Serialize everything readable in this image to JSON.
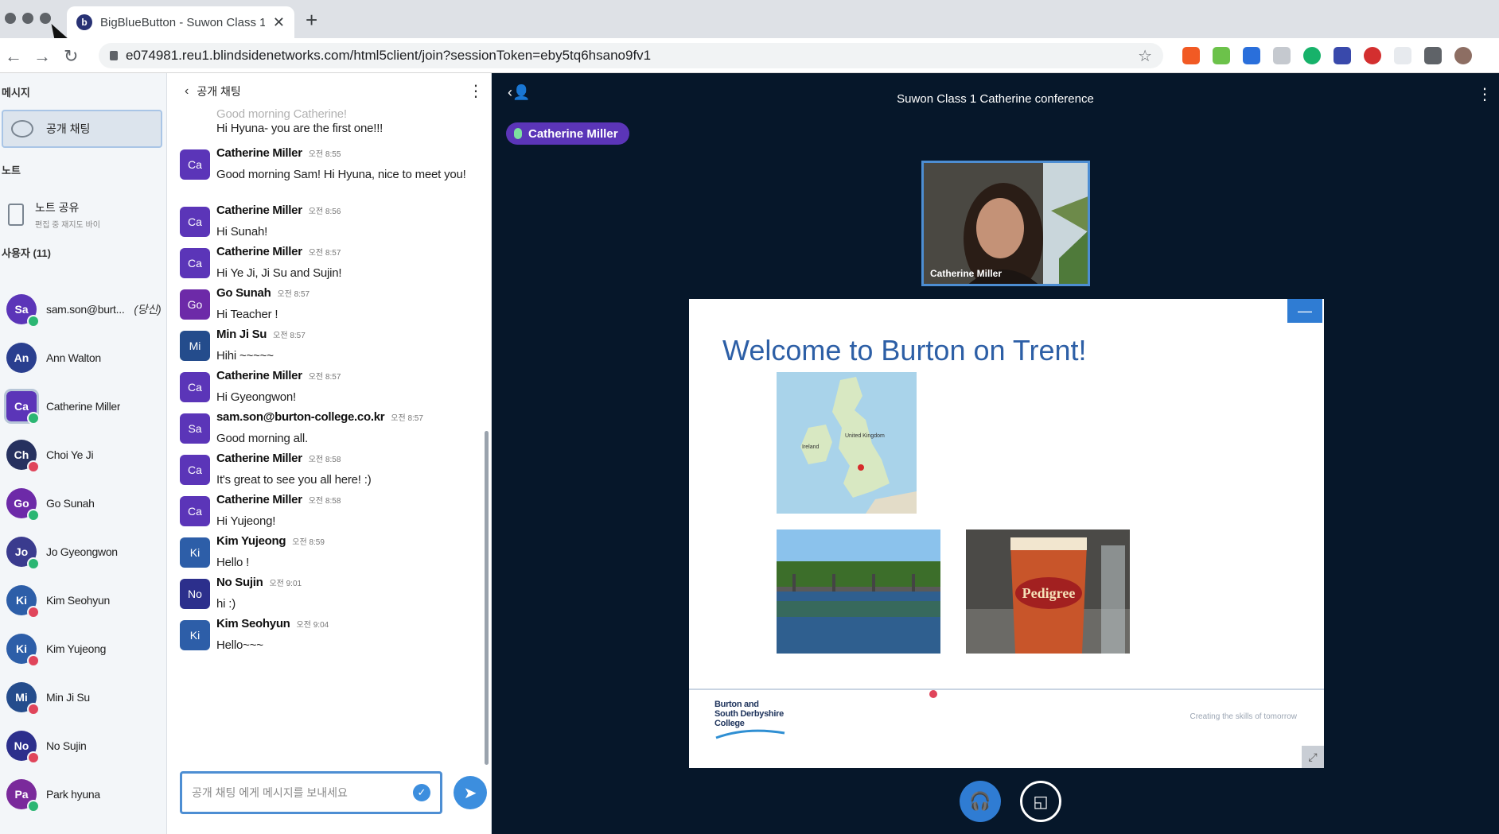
{
  "browser": {
    "tab_title": "BigBlueButton - Suwon Class 1",
    "tab_favicon": "b",
    "url": "e074981.reu1.blindsidenetworks.com/html5client/join?sessionToken=eby5tq6hsano9fv1"
  },
  "left": {
    "messages_heading": "메시지",
    "public_chat_label": "공개 채팅",
    "notes_heading": "노트",
    "notes_title": "노트 공유",
    "notes_subtitle": "편집 중 재지도 바이",
    "users_heading": "사용자 (11)",
    "you_tag": "(당신)",
    "users": [
      {
        "initials": "Sa",
        "name": "sam.son@burt...",
        "avatar_color": "#5b35b8",
        "status": "mic-on"
      },
      {
        "initials": "An",
        "name": "Ann Walton",
        "avatar_color": "#2a3f8f",
        "status": "none"
      },
      {
        "initials": "Ca",
        "name": "Catherine Miller",
        "avatar_color": "#5b35b8",
        "status": "mic-on"
      },
      {
        "initials": "Ch",
        "name": "Choi Ye Ji",
        "avatar_color": "#26315f",
        "status": "muted"
      },
      {
        "initials": "Go",
        "name": "Go Sunah",
        "avatar_color": "#6d2aa8",
        "status": "mic-on"
      },
      {
        "initials": "Jo",
        "name": "Jo Gyeongwon",
        "avatar_color": "#3a3b8e",
        "status": "mic-on"
      },
      {
        "initials": "Ki",
        "name": "Kim Seohyun",
        "avatar_color": "#2d5ea8",
        "status": "muted"
      },
      {
        "initials": "Ki",
        "name": "Kim Yujeong",
        "avatar_color": "#2d5ea8",
        "status": "muted"
      },
      {
        "initials": "Mi",
        "name": "Min Ji Su",
        "avatar_color": "#244c8c",
        "status": "muted"
      },
      {
        "initials": "No",
        "name": "No Sujin",
        "avatar_color": "#2c2f8c",
        "status": "muted"
      },
      {
        "initials": "Pa",
        "name": "Park hyuna",
        "avatar_color": "#7a2a9b",
        "status": "mic-on"
      }
    ]
  },
  "chat": {
    "title": "공개 채팅",
    "partial_top_text": "Good morning Catherine!",
    "partial_top_line": "Hi Hyuna- you are the first one!!!",
    "messages": [
      {
        "initials": "Ca",
        "name": "Catherine Miller",
        "time": "오전 8:55",
        "text": "Good morning Sam! Hi Hyuna, nice to meet you!",
        "color": "#5b35b8"
      },
      {
        "initials": "Ca",
        "name": "Catherine Miller",
        "time": "오전 8:56",
        "text": "Hi Sunah!",
        "color": "#5b35b8"
      },
      {
        "initials": "Ca",
        "name": "Catherine Miller",
        "time": "오전 8:57",
        "text": "Hi Ye Ji, Ji Su and Sujin!",
        "color": "#5b35b8"
      },
      {
        "initials": "Go",
        "name": "Go Sunah",
        "time": "오전 8:57",
        "text": "Hi Teacher !",
        "color": "#6d2aa8"
      },
      {
        "initials": "Mi",
        "name": "Min Ji Su",
        "time": "오전 8:57",
        "text": "Hihi ~~~~~",
        "color": "#244c8c"
      },
      {
        "initials": "Ca",
        "name": "Catherine Miller",
        "time": "오전 8:57",
        "text": "Hi Gyeongwon!",
        "color": "#5b35b8"
      },
      {
        "initials": "Sa",
        "name": "sam.son@burton-college.co.kr",
        "time": "오전 8:57",
        "text": "Good morning all.",
        "color": "#5b35b8"
      },
      {
        "initials": "Ca",
        "name": "Catherine Miller",
        "time": "오전 8:58",
        "text": "It's great to see you all here! :)",
        "color": "#5b35b8"
      },
      {
        "initials": "Ca",
        "name": "Catherine Miller",
        "time": "오전 8:58",
        "text": "Hi Yujeong!",
        "color": "#5b35b8"
      },
      {
        "initials": "Ki",
        "name": "Kim Yujeong",
        "time": "오전 8:59",
        "text": "Hello !",
        "color": "#2d5ea8"
      },
      {
        "initials": "No",
        "name": "No Sujin",
        "time": "오전 9:01",
        "text": "hi :)",
        "color": "#2c2f8c"
      },
      {
        "initials": "Ki",
        "name": "Kim Seohyun",
        "time": "오전 9:04",
        "text": "Hello~~~",
        "color": "#2d5ea8"
      }
    ],
    "input_placeholder": "공개 채팅 에게 메시지를 보내세요"
  },
  "main": {
    "meeting_title": "Suwon Class 1 Catherine conference",
    "talking_indicator": "Catherine Miller",
    "webcam_name": "Catherine Miller",
    "slide_title": "Welcome to Burton on Trent!",
    "logo_lines": [
      "Burton and",
      "South Derbyshire",
      "College"
    ],
    "tagline": "Creating the skills of tomorrow",
    "beer_brand": "Pedigree",
    "map_labels": [
      "United Kingdom",
      "Ireland"
    ]
  },
  "colors": {
    "accent": "#2f7cd3",
    "presentation_bg": "#06172a",
    "talker_purple": "#5b35b8",
    "status_on": "#2bb673",
    "status_muted": "#e0455b"
  }
}
